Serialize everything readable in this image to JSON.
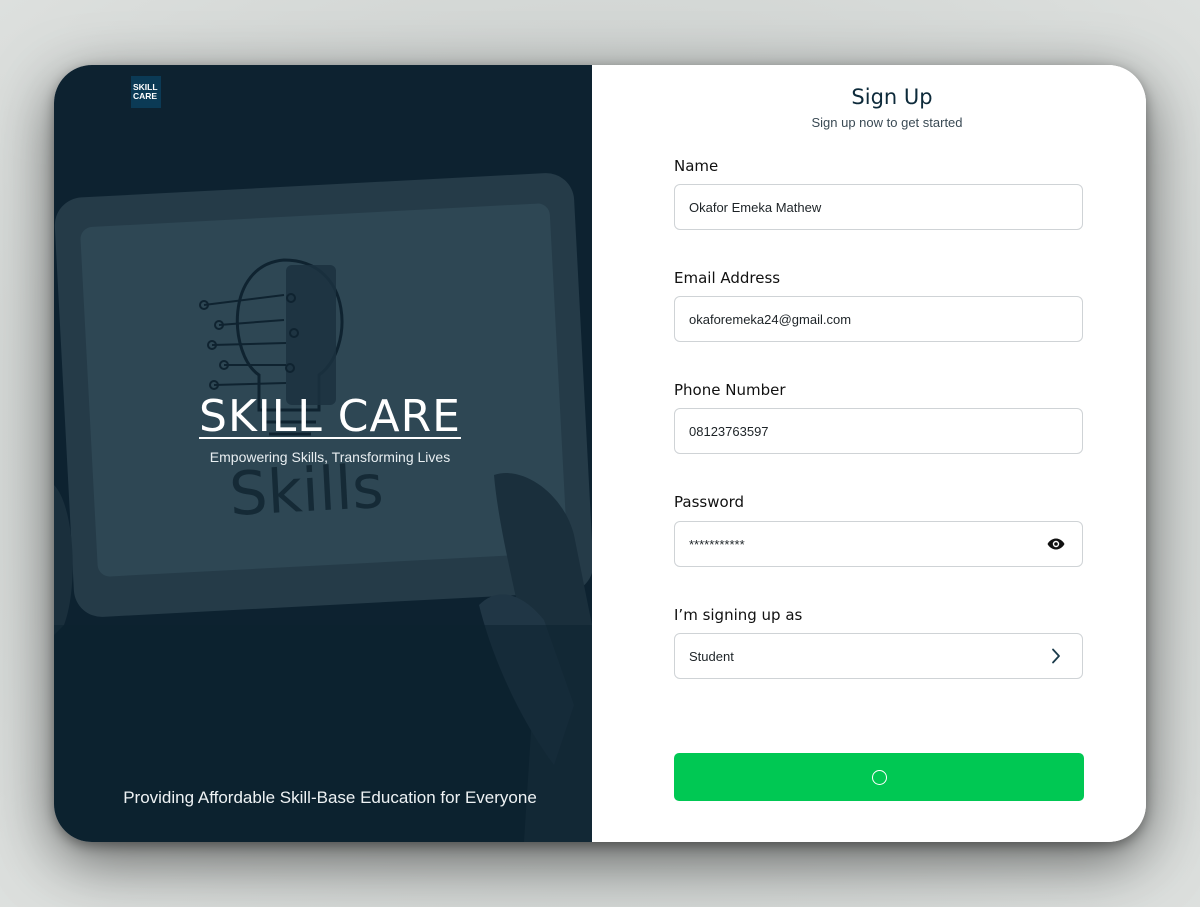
{
  "hero": {
    "logo_line1": "SKILL",
    "logo_line2": "CARE",
    "photo_word": "Skills",
    "brand_title": "SKILL CARE",
    "tagline": "Empowering Skills, Transforming Lives",
    "footer": "Providing Affordable Skill-Base Education for Everyone"
  },
  "form": {
    "title": "Sign Up",
    "subtitle": "Sign up now to get started",
    "fields": [
      {
        "label": "Name",
        "value": "Okafor Emeka Mathew"
      },
      {
        "label": "Email Address",
        "value": "okaforemeka24@gmail.com"
      },
      {
        "label": "Phone Number",
        "value": "08123763597"
      },
      {
        "label": "Password",
        "value": "***********",
        "icon": "eye-icon"
      },
      {
        "label": "I’m signing up as",
        "value": "Student",
        "icon": "chevron-right-icon"
      }
    ],
    "submit_state": "loading"
  },
  "colors": {
    "hero_bg": "#0d2230",
    "accent_green": "#00c853",
    "title_navy": "#0d2a3a"
  }
}
